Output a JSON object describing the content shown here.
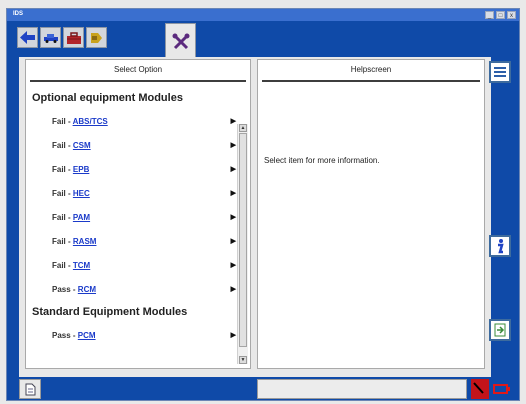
{
  "window": {
    "title": "IDS",
    "controls": [
      "_",
      "□",
      "x"
    ]
  },
  "toolbar": {
    "icons": [
      "back-arrow-icon",
      "vehicle-icon",
      "toolbox-icon",
      "module-icon"
    ],
    "active_tab_icon": "wrench-icon"
  },
  "left_panel": {
    "header": "Select Option",
    "sections": [
      {
        "title": "Optional equipment Modules",
        "items": [
          {
            "status": "Fail - ",
            "module": "ABS/TCS"
          },
          {
            "status": "Fail - ",
            "module": "CSM"
          },
          {
            "status": "Fail - ",
            "module": "EPB"
          },
          {
            "status": "Fail - ",
            "module": "HEC"
          },
          {
            "status": "Fail - ",
            "module": "PAM"
          },
          {
            "status": "Fail - ",
            "module": "RASM"
          },
          {
            "status": "Fail - ",
            "module": "TCM"
          },
          {
            "status": "Pass - ",
            "module": "RCM"
          }
        ]
      },
      {
        "title": "Standard Equipment Modules",
        "items": [
          {
            "status": "Pass - ",
            "module": "PCM"
          }
        ]
      }
    ]
  },
  "right_panel": {
    "header": "Helpscreen",
    "message": "Select item for more information."
  },
  "sidebar": {
    "icons": [
      "list-icon",
      "info-icon",
      "export-icon"
    ]
  },
  "statusbar": {
    "icons": [
      "document-icon",
      "error-indicator-icon",
      "battery-icon"
    ]
  },
  "colors": {
    "window_blue": "#0f4aa8",
    "link_blue": "#1a3ac9",
    "error_red": "#c3141a"
  }
}
